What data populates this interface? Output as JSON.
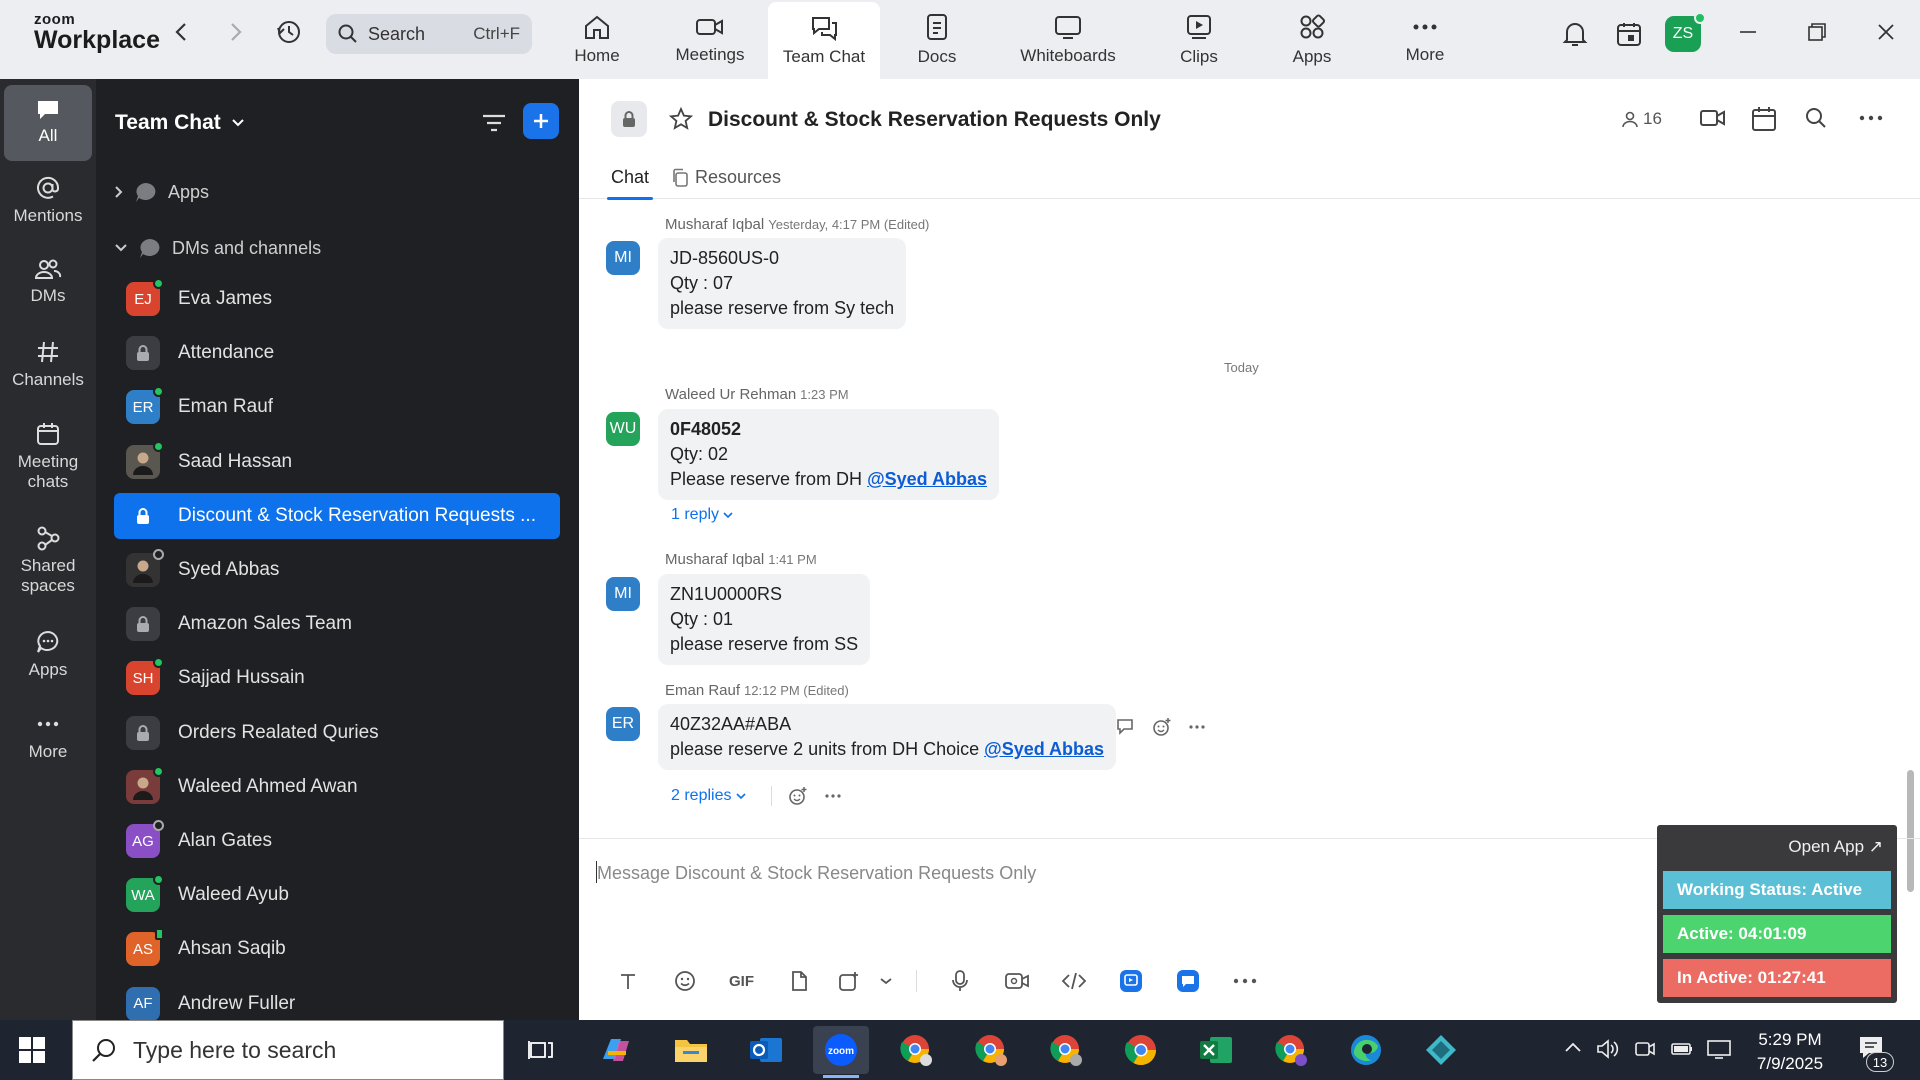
{
  "app": {
    "logo_small": "zoom",
    "logo_big": "Workplace"
  },
  "search": {
    "placeholder": "Search",
    "shortcut": "Ctrl+F"
  },
  "nav_tabs": [
    {
      "label": "Home"
    },
    {
      "label": "Meetings"
    },
    {
      "label": "Team Chat"
    },
    {
      "label": "Docs"
    },
    {
      "label": "Whiteboards"
    },
    {
      "label": "Clips"
    },
    {
      "label": "Apps"
    },
    {
      "label": "More"
    }
  ],
  "user_avatar": "ZS",
  "rail": [
    {
      "label": "All"
    },
    {
      "label": "Mentions"
    },
    {
      "label": "DMs"
    },
    {
      "label": "Channels"
    },
    {
      "label": "Meeting chats"
    },
    {
      "label": "Shared spaces"
    },
    {
      "label": "Apps"
    },
    {
      "label": "More"
    }
  ],
  "sidebar": {
    "title": "Team Chat",
    "sections": [
      {
        "label": "Apps"
      },
      {
        "label": "DMs and channels"
      }
    ],
    "items": [
      {
        "label": "Eva James",
        "initials": "EJ",
        "color": "#d9442e",
        "status": "online"
      },
      {
        "label": "Attendance",
        "initials": "",
        "color": "#3b3d42",
        "status": "lock"
      },
      {
        "label": "Eman Rauf",
        "initials": "ER",
        "color": "#2f7fc8",
        "status": "online"
      },
      {
        "label": "Saad Hassan",
        "initials": "",
        "color": "#5a5650",
        "status": "online"
      },
      {
        "label": "Discount & Stock Reservation Requests ...",
        "initials": "",
        "color": "#0e72ed",
        "status": "lock",
        "selected": true
      },
      {
        "label": "Syed Abbas",
        "initials": "",
        "color": "#333333",
        "status": "away"
      },
      {
        "label": "Amazon Sales Team",
        "initials": "",
        "color": "#3b3d42",
        "status": "lock"
      },
      {
        "label": "Sajjad Hussain",
        "initials": "SH",
        "color": "#d9442e",
        "status": "online"
      },
      {
        "label": "Orders Realated Quries",
        "initials": "",
        "color": "#3b3d42",
        "status": "lock"
      },
      {
        "label": "Waleed Ahmed Awan",
        "initials": "",
        "color": "#7a3b3b",
        "status": "online"
      },
      {
        "label": "Alan Gates",
        "initials": "AG",
        "color": "#8a4fc4",
        "status": "away"
      },
      {
        "label": "Waleed Ayub",
        "initials": "WA",
        "color": "#24a35a",
        "status": "online"
      },
      {
        "label": "Ahsan Saqib",
        "initials": "AS",
        "color": "#e0642a",
        "status": "mobile"
      },
      {
        "label": "Andrew Fuller",
        "initials": "AF",
        "color": "#2f6fb0",
        "status": "none"
      }
    ]
  },
  "channel": {
    "title": "Discount & Stock Reservation Requests Only",
    "member_count": "16",
    "tabs": [
      {
        "label": "Chat"
      },
      {
        "label": "Resources"
      }
    ]
  },
  "messages": [
    {
      "author": "Musharaf Iqbal",
      "time": "Yesterday, 4:17 PM (Edited)",
      "initials": "MI",
      "color": "#2f7fc8",
      "lines": [
        "JD-8560US-0",
        "Qty : 07",
        "please reserve from Sy tech"
      ]
    },
    {
      "day_separator": "Today"
    },
    {
      "author": "Waleed Ur Rehman",
      "time": "1:23 PM",
      "initials": "WU",
      "color": "#24a35a",
      "line1": "0F48052",
      "line2": "Qty: 02",
      "line3_prefix": "Please reserve from DH ",
      "mention": "@Syed Abbas",
      "replies": "1 reply"
    },
    {
      "author": "Musharaf Iqbal",
      "time": "1:41 PM",
      "initials": "MI",
      "color": "#2f7fc8",
      "lines": [
        "ZN1U0000RS",
        "Qty : 01",
        "please reserve from SS"
      ]
    },
    {
      "author": "Eman Rauf",
      "time": "12:12 PM (Edited)",
      "initials": "ER",
      "color": "#2f7fc8",
      "line1": "40Z32AA#ABA",
      "line2_prefix": "please reserve 2 units from DH Choice ",
      "mention": "@Syed Abbas",
      "replies": "2 replies"
    }
  ],
  "composer": {
    "placeholder": "Message Discount & Stock Reservation Requests Only",
    "gif_label": "GIF"
  },
  "widget": {
    "open_app": "Open App ↗",
    "working_status": "Working Status: Active",
    "active": "Active: 04:01:09",
    "inactive": "In Active: 01:27:41",
    "colors": {
      "status": "#5bc0d6",
      "active": "#4cd46e",
      "inactive": "#ec6b63"
    }
  },
  "taskbar": {
    "search_placeholder": "Type here to search",
    "time": "5:29 PM",
    "date": "7/9/2025",
    "notification_count": "13"
  },
  "colors": {
    "accent": "#0e72ed",
    "sidebar_bg": "#1f2023",
    "rail_bg": "#292b2f"
  }
}
